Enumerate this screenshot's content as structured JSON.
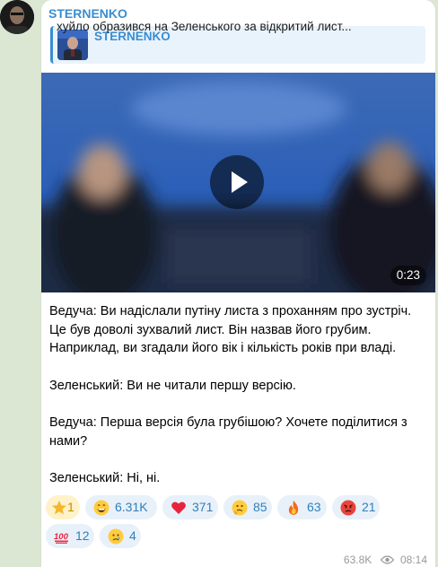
{
  "post": {
    "channel": "STERNENKO",
    "reply": {
      "title": "STERNENKO",
      "text": "хуйло образився на Зеленського за відкритий лист..."
    },
    "video": {
      "duration": "0:23"
    },
    "paragraphs": [
      "Ведуча: Ви надіслали путіну листа з проханням про зустріч. Це був доволі зухвалий лист. Він назвав його грубим. Наприклад, ви згадали його вік і кількість років при владі.",
      "Зеленський: Ви не читали першу версію.",
      "Ведуча: Перша версія була грубішою? Хочете поділитися з нами?",
      "Зеленський: Ні, ні."
    ],
    "reactions": [
      {
        "emoji": "star",
        "count": "1"
      },
      {
        "emoji": "grin",
        "count": "6.31K"
      },
      {
        "emoji": "heart",
        "count": "371"
      },
      {
        "emoji": "thinking",
        "count": "85"
      },
      {
        "emoji": "fire",
        "count": "63"
      },
      {
        "emoji": "angry",
        "count": "21"
      },
      {
        "emoji": "100",
        "count": "12"
      },
      {
        "emoji": "sad",
        "count": "4"
      }
    ],
    "views": "63.8K",
    "time": "08:14"
  },
  "colors": {
    "accent": "#3a8dd1",
    "chat_bg": "#dbe6d3",
    "reaction_bg": "#e8f1f9"
  }
}
